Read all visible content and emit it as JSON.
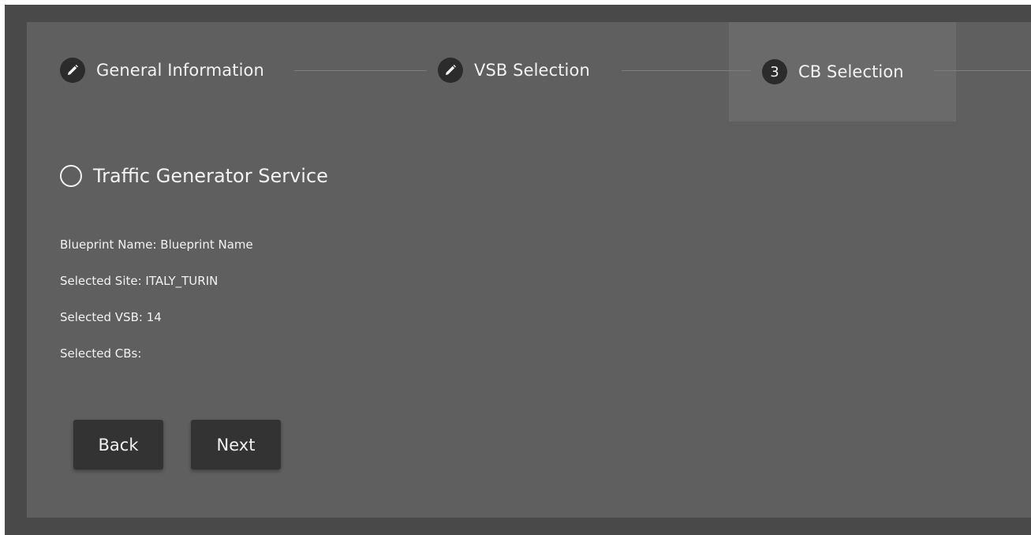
{
  "stepper": {
    "steps": [
      {
        "label": "General Information",
        "marker": "pencil-icon"
      },
      {
        "label": "VSB Selection",
        "marker": "pencil-icon"
      },
      {
        "label": "CB Selection",
        "number": "3"
      }
    ],
    "active_step": 3
  },
  "service": {
    "label": "Traffic Generator Service",
    "selected": false
  },
  "info": {
    "blueprint_name": "Blueprint Name: Blueprint Name",
    "selected_site": "Selected Site: ITALY_TURIN",
    "selected_vsb": "Selected VSB: 14",
    "selected_cbs": "Selected CBs:"
  },
  "actions": {
    "back_label": "Back",
    "next_label": "Next"
  },
  "colors": {
    "outer_background": "#494949",
    "panel_background": "#5f5f5f",
    "active_step_background": "#6a6a6a",
    "step_circle": "#2b2b2b",
    "button_background": "#333333",
    "text": "#f2f2f2"
  }
}
